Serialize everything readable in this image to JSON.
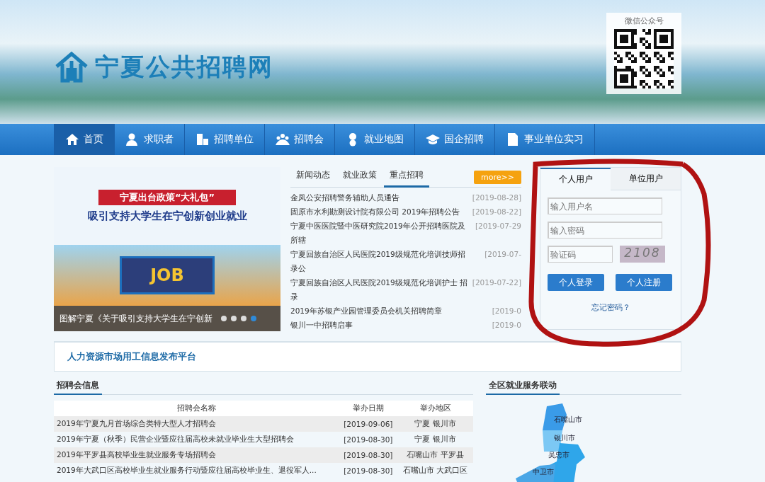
{
  "header": {
    "site_title": "宁夏公共招聘网",
    "qr_label": "微信公众号"
  },
  "nav": [
    {
      "label": "首页",
      "kind": "home",
      "selected": true
    },
    {
      "label": "求职者",
      "kind": "person",
      "selected": false
    },
    {
      "label": "招聘单位",
      "kind": "building",
      "selected": false
    },
    {
      "label": "招聘会",
      "kind": "group",
      "selected": false
    },
    {
      "label": "就业地图",
      "kind": "pin",
      "selected": false
    },
    {
      "label": "国企招聘",
      "kind": "cap",
      "selected": false
    },
    {
      "label": "事业单位实习",
      "kind": "doc",
      "selected": false
    }
  ],
  "slider": {
    "banner_title": "宁夏出台政策“大礼包”",
    "banner_subtitle": "吸引支持大学生在宁创新创业就业",
    "illustration_text": "JOB",
    "caption": "图解宁夏《关于吸引支持大学生在宁创新",
    "dots": [
      {
        "selected": false
      },
      {
        "selected": false
      },
      {
        "selected": false
      },
      {
        "selected": true
      }
    ]
  },
  "news": {
    "tabs": [
      {
        "label": "新闻动态",
        "selected": false
      },
      {
        "label": "就业政策",
        "selected": false
      },
      {
        "label": "重点招聘",
        "selected": true
      }
    ],
    "more": "more>>",
    "items": [
      {
        "title": "金凤公安招聘警务辅助人员通告",
        "date": "[2019-08-28]"
      },
      {
        "title": "固原市水利勘测设计院有限公司 2019年招聘公告",
        "date": "[2019-08-22]"
      },
      {
        "title": "宁夏中医医院暨中医研究院2019年公开招聘医院及所辖",
        "date": "[2019-07-29"
      },
      {
        "title": "宁夏回族自治区人民医院2019级规范化培训技师招录公",
        "date": "[2019-07-"
      },
      {
        "title": "宁夏回族自治区人民医院2019级规范化培训护士 招录",
        "date": "[2019-07-22]"
      },
      {
        "title": "2019年苏银产业园管理委员会机关招聘简章",
        "date": "[2019-0"
      },
      {
        "title": "银川一中招聘启事",
        "date": "[2019-0"
      }
    ]
  },
  "login": {
    "tabs": [
      {
        "label": "个人用户",
        "selected": true
      },
      {
        "label": "单位用户",
        "selected": false
      }
    ],
    "username": {
      "placeholder": "输入用户名"
    },
    "password": {
      "placeholder": "输入密码"
    },
    "captcha": {
      "placeholder": "验证码"
    },
    "captcha_code": "2108",
    "buttons": [
      "个人登录",
      "个人注册"
    ],
    "forgot": "忘记密码？"
  },
  "platform": {
    "title": "人力资源市场用工信息发布平台"
  },
  "fairs": {
    "title": "招聘会信息",
    "columns": [
      "招聘会名称",
      "举办日期",
      "举办地区"
    ],
    "rows": [
      [
        "2019年宁夏九月首场综合类特大型人才招聘会",
        "[2019-09-06]",
        "宁夏 银川市"
      ],
      [
        "2019年宁夏（秋季）民营企业暨应往届高校未就业毕业生大型招聘会",
        "[2019-08-30]",
        "宁夏 银川市"
      ],
      [
        "2019年平罗县高校毕业生就业服务专场招聘会",
        "[2019-08-30]",
        "石嘴山市 平罗县"
      ],
      [
        "2019年大武口区高校毕业生就业服务行动暨应往届高校毕业生、退役军人...",
        "[2019-08-30]",
        "石嘴山市 大武口区"
      ]
    ]
  },
  "linkage": {
    "title": "全区就业服务联动",
    "cities": [
      "石嘴山市",
      "银川市",
      "吴忠市",
      "中卫市"
    ]
  }
}
